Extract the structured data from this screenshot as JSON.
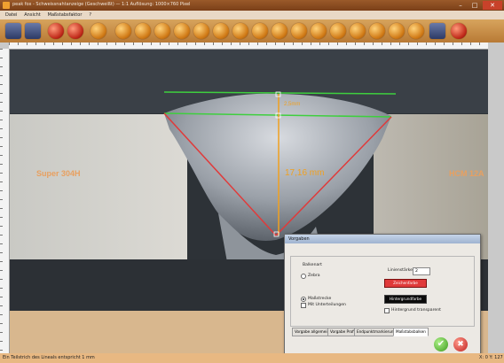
{
  "window": {
    "title": "peak fox - Schweissnahtanzeige (Geschweißt) — 1:1 Auflösung: 1000×760 Pixel",
    "controls": [
      "–",
      "□",
      "✕"
    ]
  },
  "menu": [
    "Datei",
    "Ansicht",
    "Maßstabsfaktor",
    "?"
  ],
  "toolbar": {
    "buttons": [
      "open-icon",
      "save-icon",
      "print-icon",
      "export-icon",
      "settings-icon",
      "line-icon",
      "rotate-icon",
      "angle-icon",
      "arc-icon",
      "circle-icon",
      "refresh-icon",
      "polygon-icon",
      "measure-icon",
      "ruler-icon",
      "area-icon",
      "photo-icon",
      "zoom-in-icon",
      "zoom-out-icon",
      "zoom-fit-icon",
      "pan-icon",
      "layer-icon",
      "palette-icon",
      "close-icon"
    ]
  },
  "image": {
    "left_material": "Super 304H",
    "right_material": "HCM 12A",
    "height_label": "2,5mm",
    "depth_label": "17,16 mm",
    "colors": {
      "measure_red": "#e03a3a",
      "measure_green": "#3ecf3e",
      "measure_orange": "#f0a020",
      "material_text": "#e8a060"
    }
  },
  "dialog": {
    "title": "Vorgaben",
    "group_label": "Balkenart",
    "radio_zebra": "Zebra",
    "radio_massstab": "Maßstrecke",
    "check_unterteilung": "Mit Unterteilungen",
    "linewidth_label": "Linienstärke:",
    "linewidth_value": "2",
    "color_primary_label": "Zeichenfarbe",
    "color_background_label": "Hintergrundfarbe",
    "check_transparent": "Hintergrund transparent",
    "tabs": [
      "Vorgabe allgemein",
      "Vorgabe Profil",
      "Endpunktmarkierung",
      "Maßstabsbalken"
    ],
    "selected_tab": "Maßstabsbalken",
    "ok_symbol": "✔",
    "cancel_symbol": "✖"
  },
  "status": {
    "left": "Ein Teilstrich des Lineals entspricht 1 mm",
    "right": "X: 0 Y: 127"
  }
}
